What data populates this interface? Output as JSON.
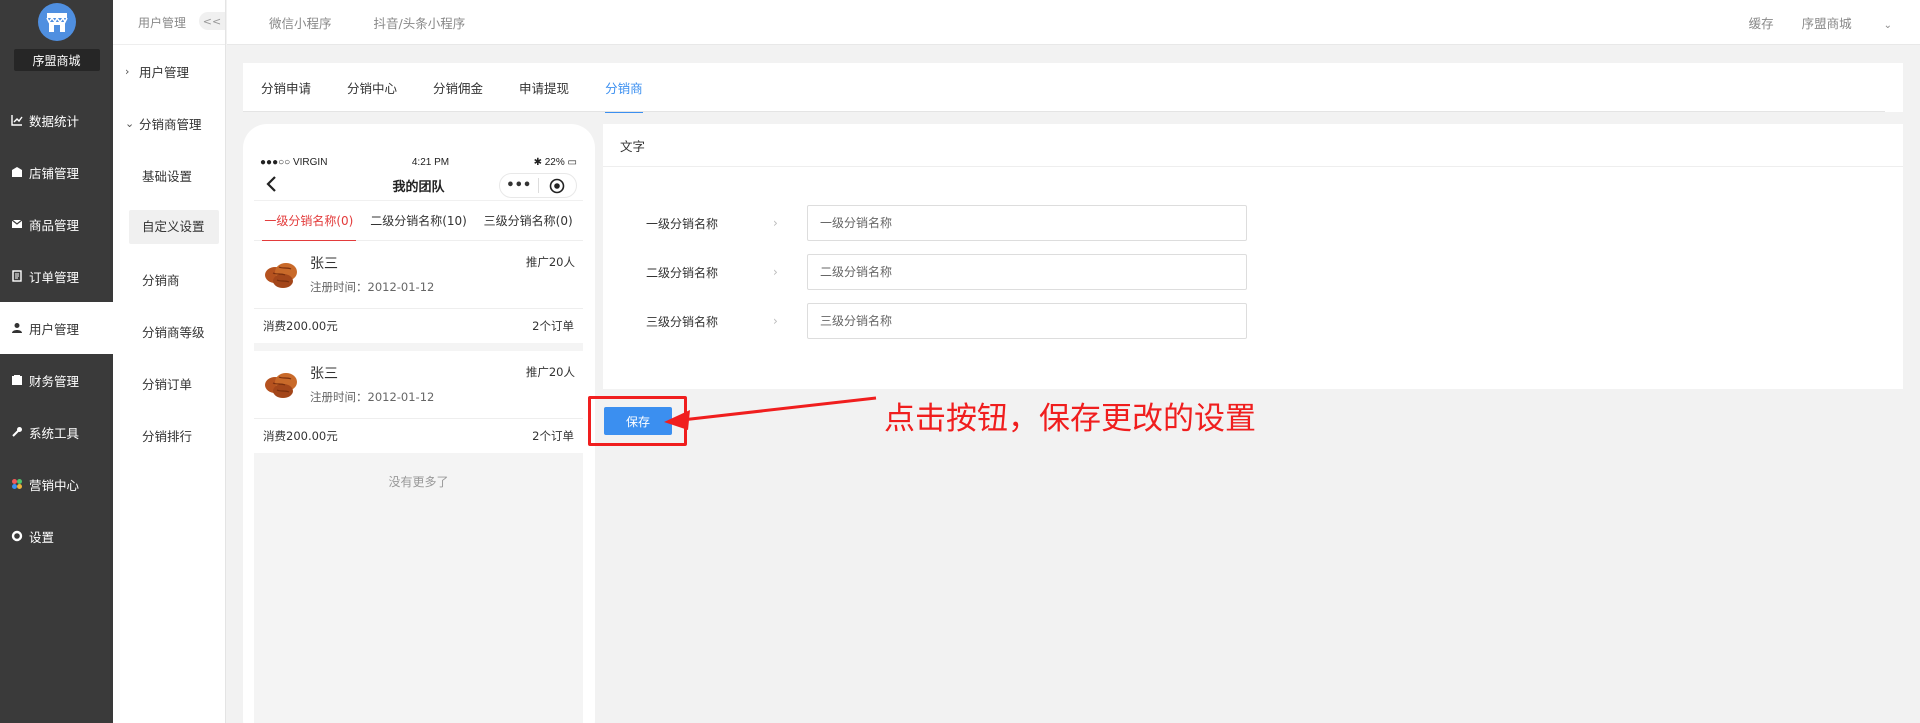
{
  "sidebar": {
    "shop_name": "序盟商城",
    "items": [
      {
        "label": "数据统计",
        "icon": "chart-icon"
      },
      {
        "label": "店铺管理",
        "icon": "store-icon"
      },
      {
        "label": "商品管理",
        "icon": "product-icon"
      },
      {
        "label": "订单管理",
        "icon": "order-icon"
      },
      {
        "label": "用户管理",
        "icon": "user-icon",
        "active": true
      },
      {
        "label": "财务管理",
        "icon": "finance-icon"
      },
      {
        "label": "系统工具",
        "icon": "wrench-icon"
      },
      {
        "label": "营销中心",
        "icon": "marketing-icon"
      },
      {
        "label": "设置",
        "icon": "gear-icon"
      }
    ]
  },
  "submenu": {
    "title": "用户管理",
    "collapse_label": "<<",
    "groups": [
      {
        "label": "用户管理"
      },
      {
        "label": "分销商管理"
      }
    ],
    "items": [
      {
        "label": "基础设置"
      },
      {
        "label": "自定义设置",
        "active": true
      },
      {
        "label": "分销商"
      },
      {
        "label": "分销商等级"
      },
      {
        "label": "分销订单"
      },
      {
        "label": "分销排行"
      }
    ]
  },
  "header": {
    "links": [
      "微信小程序",
      "抖音/头条小程序"
    ],
    "cache": "缓存",
    "account": "序盟商城"
  },
  "tabs": [
    {
      "label": "分销申请"
    },
    {
      "label": "分销中心"
    },
    {
      "label": "分销佣金"
    },
    {
      "label": "申请提现"
    },
    {
      "label": "分销商",
      "active": true
    }
  ],
  "phone": {
    "status": {
      "carrier": "●●●○○ VIRGIN",
      "time": "4:21 PM",
      "battery": "22%"
    },
    "title": "我的团队",
    "level_tabs": [
      "一级分销名称(0)",
      "二级分销名称(10)",
      "三级分销名称(0)"
    ],
    "members": [
      {
        "name": "张三",
        "date": "注册时间：2012-01-12",
        "promo": "推广20人",
        "spend": "消费200.00元",
        "orders": "2个订单"
      },
      {
        "name": "张三",
        "date": "注册时间：2012-01-12",
        "promo": "推广20人",
        "spend": "消费200.00元",
        "orders": "2个订单"
      }
    ],
    "no_more": "没有更多了"
  },
  "form": {
    "section_title": "文字",
    "rows": [
      {
        "label": "一级分销名称",
        "placeholder": "一级分销名称"
      },
      {
        "label": "二级分销名称",
        "placeholder": "二级分销名称"
      },
      {
        "label": "三级分销名称",
        "placeholder": "三级分销名称"
      }
    ],
    "save_label": "保存"
  },
  "annotation": {
    "text": "点击按钮，保存更改的设置",
    "color": "#f01e1e"
  },
  "colors": {
    "accent": "#3b8ff0",
    "sidebar_bg": "#3a3a3a",
    "tab_active_red": "#e33b3b"
  }
}
